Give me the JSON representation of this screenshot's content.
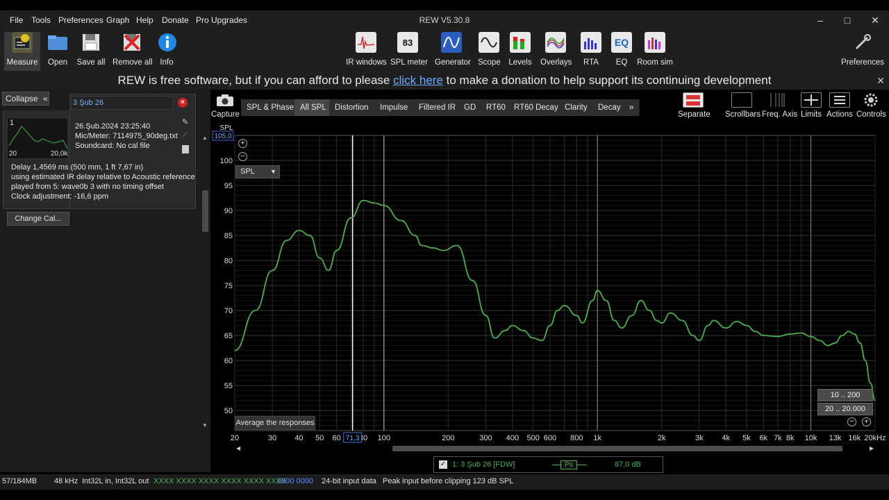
{
  "menu": [
    "File",
    "Tools",
    "Preferences",
    "Graph",
    "Help",
    "Donate",
    "Pro Upgrades"
  ],
  "app_title": "REW V5.30.8",
  "window_controls": {
    "minimize": "–",
    "maximize": "□",
    "close": "✕"
  },
  "toolbar_left": [
    {
      "label": "Measure",
      "icon": "measure-icon"
    },
    {
      "label": "Open",
      "icon": "folder-icon"
    },
    {
      "label": "Save all",
      "icon": "save-icon"
    },
    {
      "label": "Remove all",
      "icon": "remove-icon"
    },
    {
      "label": "Info",
      "icon": "info-icon"
    }
  ],
  "toolbar_center": [
    {
      "label": "IR windows",
      "icon": "ir-windows-icon"
    },
    {
      "label": "SPL meter",
      "icon": "spl-meter-icon",
      "text": "83"
    },
    {
      "label": "Generator",
      "icon": "generator-icon"
    },
    {
      "label": "Scope",
      "icon": "scope-icon"
    },
    {
      "label": "Levels",
      "icon": "levels-icon"
    },
    {
      "label": "Overlays",
      "icon": "overlays-icon"
    },
    {
      "label": "RTA",
      "icon": "rta-icon"
    },
    {
      "label": "EQ",
      "icon": "eq-icon",
      "text": "EQ"
    },
    {
      "label": "Room sim",
      "icon": "room-sim-icon"
    }
  ],
  "toolbar_right": {
    "label": "Preferences",
    "icon": "wrench-icon"
  },
  "banner": {
    "before": "REW is free software, but if you can afford to please ",
    "link": "click here",
    "after": " to make a donation to help support its continuing development"
  },
  "left_panel": {
    "collapse_label": "Collapse",
    "collapse_icon": "chevrons-left-icon",
    "measurement": {
      "name": "3 Şub 26",
      "thumb_index": "1",
      "thumb_x_min": "20",
      "thumb_x_max": "20,0k",
      "date": "26.Şub.2024 23:25:40",
      "mic_meter": "Mic/Meter: 7114975_90deg.txt",
      "soundcard": "Soundcard: No cal file",
      "delay_lines": [
        "Delay 1,4569 ms (500 mm, 1 ft 7,67 in)",
        "using estimated IR delay relative to Acoustic reference",
        "played from 5: wave0b 3 with no timing offset",
        "Clock adjustment: -16,6 ppm"
      ],
      "change_cal_label": "Change Cal..."
    }
  },
  "capture": {
    "label": "Capture",
    "icon": "camera-icon"
  },
  "tabs": [
    {
      "label": "SPL & Phase",
      "active": false
    },
    {
      "label": "All SPL",
      "active": true
    },
    {
      "label": "Distortion",
      "active": false
    },
    {
      "label": "Impulse",
      "active": false
    },
    {
      "label": "Filtered IR",
      "active": false
    },
    {
      "label": "GD",
      "active": false
    },
    {
      "label": "RT60",
      "active": false
    },
    {
      "label": "RT60 Decay",
      "active": false
    },
    {
      "label": "Clarity",
      "active": false
    },
    {
      "label": "Decay",
      "active": false
    },
    {
      "label": "»",
      "active": false
    }
  ],
  "graph_tools": [
    {
      "label": "Separate",
      "icon": "separate-icon"
    },
    {
      "label": "Scrollbars",
      "icon": "scrollbars-icon"
    },
    {
      "label": "Freq. Axis",
      "icon": "freq-axis-icon"
    },
    {
      "label": "Limits",
      "icon": "limits-icon"
    },
    {
      "label": "Actions",
      "icon": "actions-icon"
    },
    {
      "label": "Controls",
      "icon": "gear-icon"
    }
  ],
  "plot": {
    "y_axis_title": "SPL",
    "y_top_readout": "105,0",
    "x_cursor_readout": "71,3",
    "dropdown_value": "SPL",
    "average_label": "Average the responses",
    "range_buttons": [
      "10 .. 200",
      "20 .. 20.000"
    ]
  },
  "chart_data": {
    "type": "line",
    "title": "",
    "xlabel": "",
    "ylabel": "SPL",
    "x_scale": "log",
    "xlim": [
      20,
      20000
    ],
    "ylim": [
      46,
      105
    ],
    "grid": true,
    "cursor_x": 71.3,
    "x_ticks": [
      {
        "v": 20,
        "t": "20"
      },
      {
        "v": 30,
        "t": "30"
      },
      {
        "v": 40,
        "t": "40"
      },
      {
        "v": 50,
        "t": "50"
      },
      {
        "v": 60,
        "t": "60"
      },
      {
        "v": 80,
        "t": "80"
      },
      {
        "v": 100,
        "t": "100"
      },
      {
        "v": 200,
        "t": "200"
      },
      {
        "v": 300,
        "t": "300"
      },
      {
        "v": 400,
        "t": "400"
      },
      {
        "v": 500,
        "t": "500"
      },
      {
        "v": 600,
        "t": "600"
      },
      {
        "v": 800,
        "t": "800"
      },
      {
        "v": 1000,
        "t": "1k"
      },
      {
        "v": 2000,
        "t": "2k"
      },
      {
        "v": 3000,
        "t": "3k"
      },
      {
        "v": 4000,
        "t": "4k"
      },
      {
        "v": 5000,
        "t": "5k"
      },
      {
        "v": 6000,
        "t": "6k"
      },
      {
        "v": 7000,
        "t": "7k"
      },
      {
        "v": 8000,
        "t": "8k"
      },
      {
        "v": 10000,
        "t": "10k"
      },
      {
        "v": 13000,
        "t": "13k"
      },
      {
        "v": 16000,
        "t": "16k"
      },
      {
        "v": 20000,
        "t": "20kHz"
      }
    ],
    "y_ticks": [
      50,
      55,
      60,
      65,
      70,
      75,
      80,
      85,
      90,
      95,
      100
    ],
    "series": [
      {
        "name": "1: 3 Şub 26 [FDW]",
        "color": "#4caf50",
        "points": [
          [
            20,
            62.0
          ],
          [
            25,
            70.0
          ],
          [
            30,
            78.0
          ],
          [
            35,
            84.0
          ],
          [
            40,
            86.0
          ],
          [
            45,
            85.0
          ],
          [
            50,
            80.5
          ],
          [
            55,
            78.0
          ],
          [
            60,
            82.0
          ],
          [
            70,
            88.5
          ],
          [
            80,
            92.0
          ],
          [
            90,
            91.5
          ],
          [
            100,
            91.0
          ],
          [
            120,
            88.0
          ],
          [
            140,
            85.0
          ],
          [
            150,
            83.0
          ],
          [
            170,
            82.5
          ],
          [
            190,
            82.0
          ],
          [
            220,
            83.0
          ],
          [
            260,
            76.0
          ],
          [
            300,
            69.0
          ],
          [
            330,
            64.5
          ],
          [
            370,
            66.0
          ],
          [
            400,
            67.0
          ],
          [
            450,
            66.0
          ],
          [
            500,
            64.5
          ],
          [
            550,
            64.0
          ],
          [
            600,
            67.0
          ],
          [
            650,
            70.0
          ],
          [
            700,
            71.0
          ],
          [
            800,
            69.0
          ],
          [
            850,
            67.5
          ],
          [
            950,
            72.0
          ],
          [
            1000,
            74.0
          ],
          [
            1100,
            72.0
          ],
          [
            1200,
            68.0
          ],
          [
            1300,
            66.5
          ],
          [
            1450,
            69.0
          ],
          [
            1600,
            72.0
          ],
          [
            1750,
            70.0
          ],
          [
            1900,
            68.0
          ],
          [
            2000,
            67.5
          ],
          [
            2200,
            69.5
          ],
          [
            2500,
            68.0
          ],
          [
            2800,
            65.0
          ],
          [
            3000,
            64.0
          ],
          [
            3300,
            67.0
          ],
          [
            3500,
            68.0
          ],
          [
            4000,
            66.5
          ],
          [
            4500,
            67.8
          ],
          [
            5000,
            67.0
          ],
          [
            5500,
            65.8
          ],
          [
            6000,
            65.0
          ],
          [
            7000,
            64.8
          ],
          [
            8000,
            65.3
          ],
          [
            9000,
            65.5
          ],
          [
            10000,
            64.8
          ],
          [
            11000,
            64.0
          ],
          [
            12000,
            63.0
          ],
          [
            13000,
            63.5
          ],
          [
            14000,
            65.0
          ],
          [
            15000,
            65.8
          ],
          [
            16000,
            65.3
          ],
          [
            17000,
            63.5
          ],
          [
            18000,
            60.0
          ],
          [
            19000,
            55.5
          ],
          [
            20000,
            52.0
          ]
        ]
      }
    ]
  },
  "legend": {
    "checked": true,
    "name": "1: 3 Şub 26 [FDW]",
    "ps_label": "Ps",
    "value": "87,0 dB"
  },
  "status": {
    "memory": "57/184MB",
    "rate": "48 kHz",
    "format": "Int32L in, Int32L out",
    "input_levels": "XXXX XXXX  XXXX XXXX  XXXX XXXX",
    "output_levels": "0000 0000",
    "bit_depth": "24-bit input data",
    "peak": "Peak input before clipping 123 dB SPL"
  },
  "colors": {
    "trace": "#4caf50",
    "link": "#6aa9ff",
    "status_green": "#4caf50",
    "status_blue": "#5a8cff",
    "delete_red": "#cc2222"
  }
}
